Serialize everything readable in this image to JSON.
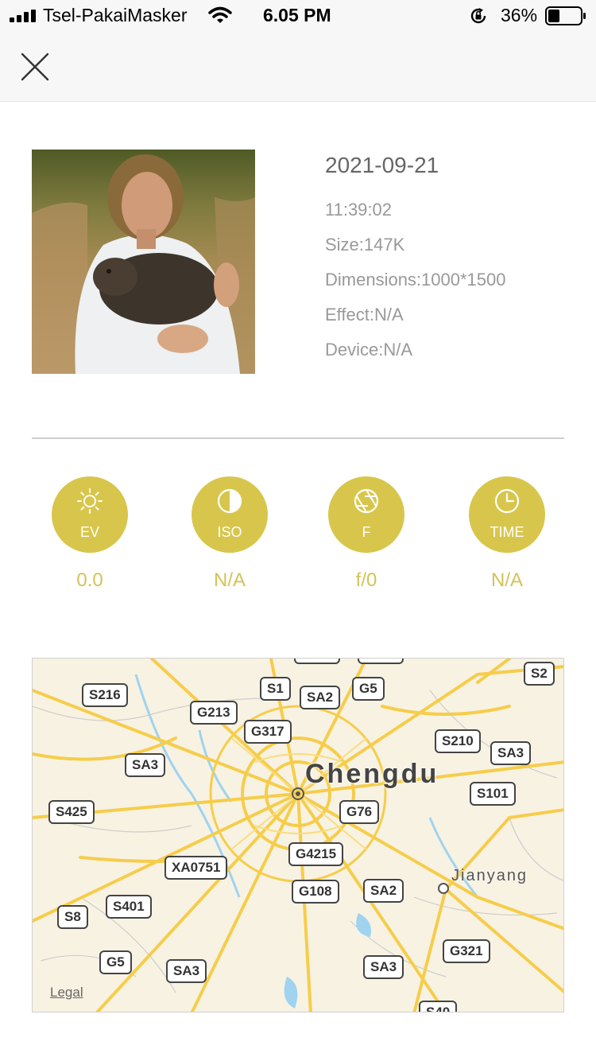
{
  "status_bar": {
    "carrier": "Tsel-PakaiMasker",
    "time": "6.05 PM",
    "battery_percent": "36%",
    "battery_level": 0.36
  },
  "nav": {
    "close_icon": "close-icon"
  },
  "photo": {
    "description_icon": "photo-thumbnail"
  },
  "info": {
    "date": "2021-09-21",
    "time": "11:39:02",
    "size": "Size:147K",
    "dimensions": "Dimensions:1000*1500",
    "effect": "Effect:N/A",
    "device": "Device:N/A"
  },
  "params": [
    {
      "label": "EV",
      "value": "0.0",
      "icon": "sun-icon"
    },
    {
      "label": "ISO",
      "value": "N/A",
      "icon": "contrast-icon"
    },
    {
      "label": "F",
      "value": "f/0",
      "icon": "aperture-icon"
    },
    {
      "label": "TIME",
      "value": "N/A",
      "icon": "clock-icon"
    }
  ],
  "map": {
    "city": "Chengdu",
    "town": "Jianyang",
    "legal": "Legal",
    "shields": [
      "S216",
      "G213",
      "S1",
      "SA2",
      "G5",
      "S2",
      "G317",
      "S210",
      "SA3",
      "SA3",
      "S101",
      "S425",
      "G76",
      "G4215",
      "XA0751",
      "G108",
      "SA2",
      "S401",
      "S8",
      "G321",
      "G5",
      "SA3",
      "SA3",
      "S40"
    ],
    "colors": {
      "road": "#f6cd4a",
      "land": "#f8f2e3",
      "water": "#9fd3ef"
    }
  }
}
